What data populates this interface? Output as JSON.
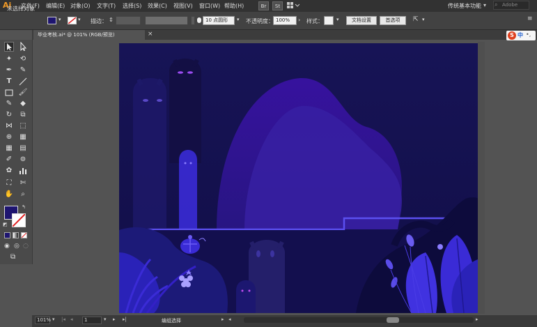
{
  "app": {
    "logo": "Ai",
    "workspace": "传统基本功能",
    "search_placeholder": "Adobe"
  },
  "menu": [
    "文件(F)",
    "编辑(E)",
    "对象(O)",
    "文字(T)",
    "选择(S)",
    "效果(C)",
    "视图(V)",
    "窗口(W)",
    "帮助(H)"
  ],
  "menubar_buttons": {
    "bridge": "Br",
    "stock": "St"
  },
  "control": {
    "selection_label": "未选择对象",
    "stroke_label": "描边：",
    "brush_value": "10 点圆形",
    "opacity_label": "不透明度：",
    "opacity_value": "100%",
    "style_label": "样式：",
    "doc_setup": "文档设置",
    "preferences": "首选项"
  },
  "document": {
    "tab_title": "毕业考核.ai* @ 101% (RGB/预览)",
    "close": "×"
  },
  "ime": {
    "s": "S",
    "zh": "中",
    "dot": "•,"
  },
  "status": {
    "zoom": "101%",
    "artboard": "1",
    "mode": "编组选择"
  },
  "colors": {
    "fill": "#1e1570",
    "stroke": "#ffffff",
    "bg_sky": "#171456",
    "bg_deep": "#120f49",
    "accent_line": "#5b4ff0",
    "arch_outer": "#33139b",
    "arch_inner": "#3b1fa6",
    "plant_blue": "#3a2bd6",
    "ghost_eye": "#9a4bf0"
  }
}
